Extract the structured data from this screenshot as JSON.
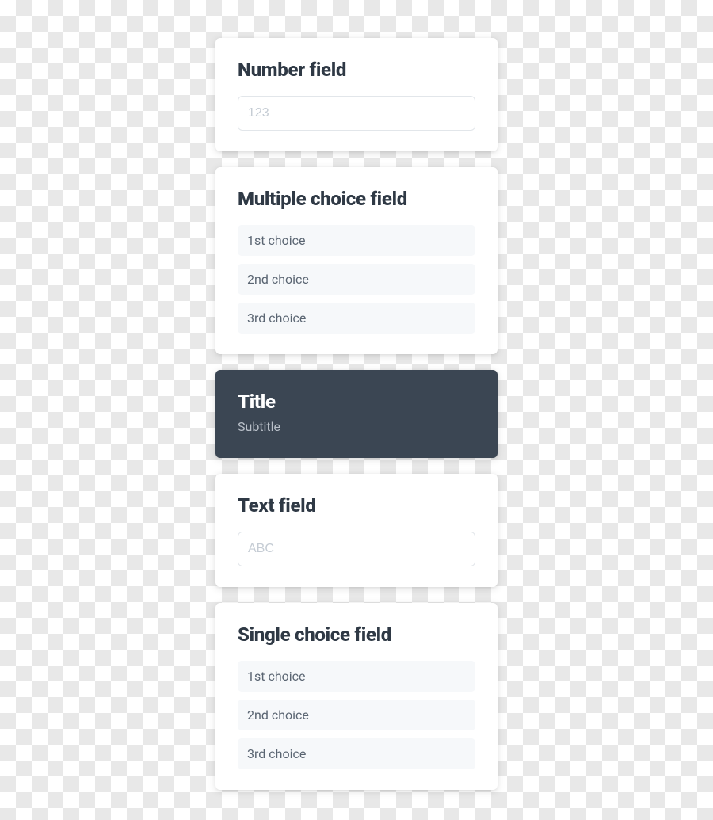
{
  "number_card": {
    "title": "Number field",
    "placeholder": "123",
    "value": ""
  },
  "multiple_choice_card": {
    "title": "Multiple choice field",
    "choices": [
      "1st choice",
      "2nd choice",
      "3rd choice"
    ]
  },
  "title_card": {
    "title": "Title",
    "subtitle": "Subtitle"
  },
  "text_card": {
    "title": "Text field",
    "placeholder": "ABC",
    "value": ""
  },
  "single_choice_card": {
    "title": "Single choice field",
    "choices": [
      "1st choice",
      "2nd choice",
      "3rd choice"
    ]
  }
}
